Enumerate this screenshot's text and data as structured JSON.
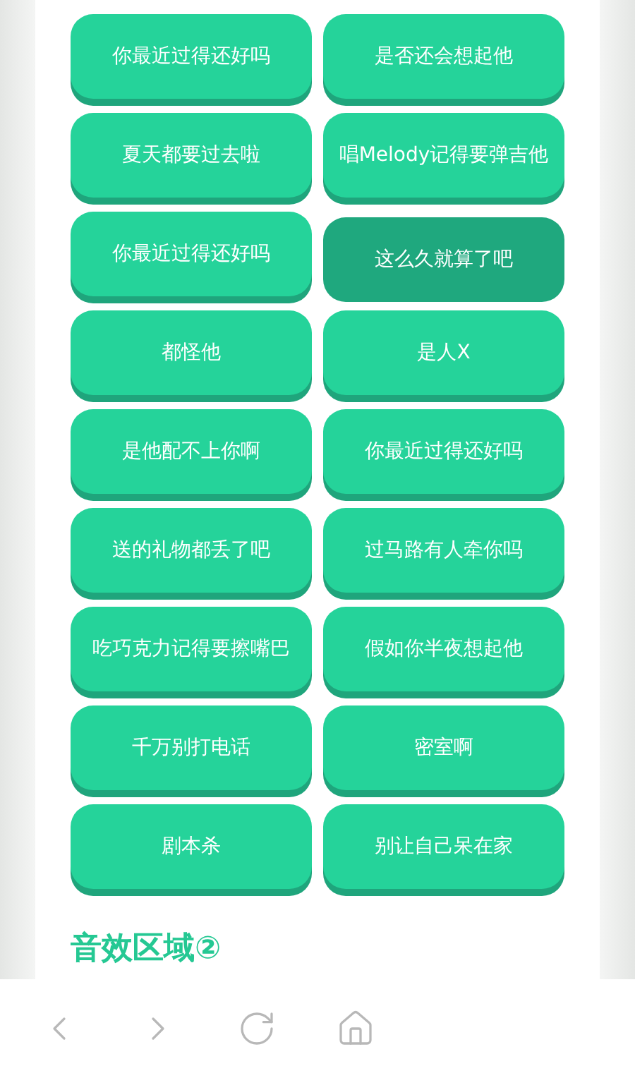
{
  "buttons": [
    {
      "label": "你最近过得还好吗",
      "pressed": false
    },
    {
      "label": "是否还会想起他",
      "pressed": false
    },
    {
      "label": "夏天都要过去啦",
      "pressed": false
    },
    {
      "label": "唱Melody记得要弹吉他",
      "pressed": false
    },
    {
      "label": "你最近过得还好吗",
      "pressed": false
    },
    {
      "label": "这么久就算了吧",
      "pressed": true
    },
    {
      "label": "都怪他",
      "pressed": false
    },
    {
      "label": "是人X",
      "pressed": false
    },
    {
      "label": "是他配不上你啊",
      "pressed": false
    },
    {
      "label": "你最近过得还好吗",
      "pressed": false
    },
    {
      "label": "送的礼物都丢了吧",
      "pressed": false
    },
    {
      "label": "过马路有人牵你吗",
      "pressed": false
    },
    {
      "label": "吃巧克力记得要擦嘴巴",
      "pressed": false
    },
    {
      "label": "假如你半夜想起他",
      "pressed": false
    },
    {
      "label": "千万别打电话",
      "pressed": false
    },
    {
      "label": "密室啊",
      "pressed": false
    },
    {
      "label": "剧本杀",
      "pressed": false
    },
    {
      "label": "别让自己呆在家",
      "pressed": false
    }
  ],
  "section_heading": "音效区域②",
  "toolbar": [
    {
      "kind": "back"
    },
    {
      "kind": "forward"
    },
    {
      "kind": "reload"
    },
    {
      "kind": "home"
    }
  ]
}
